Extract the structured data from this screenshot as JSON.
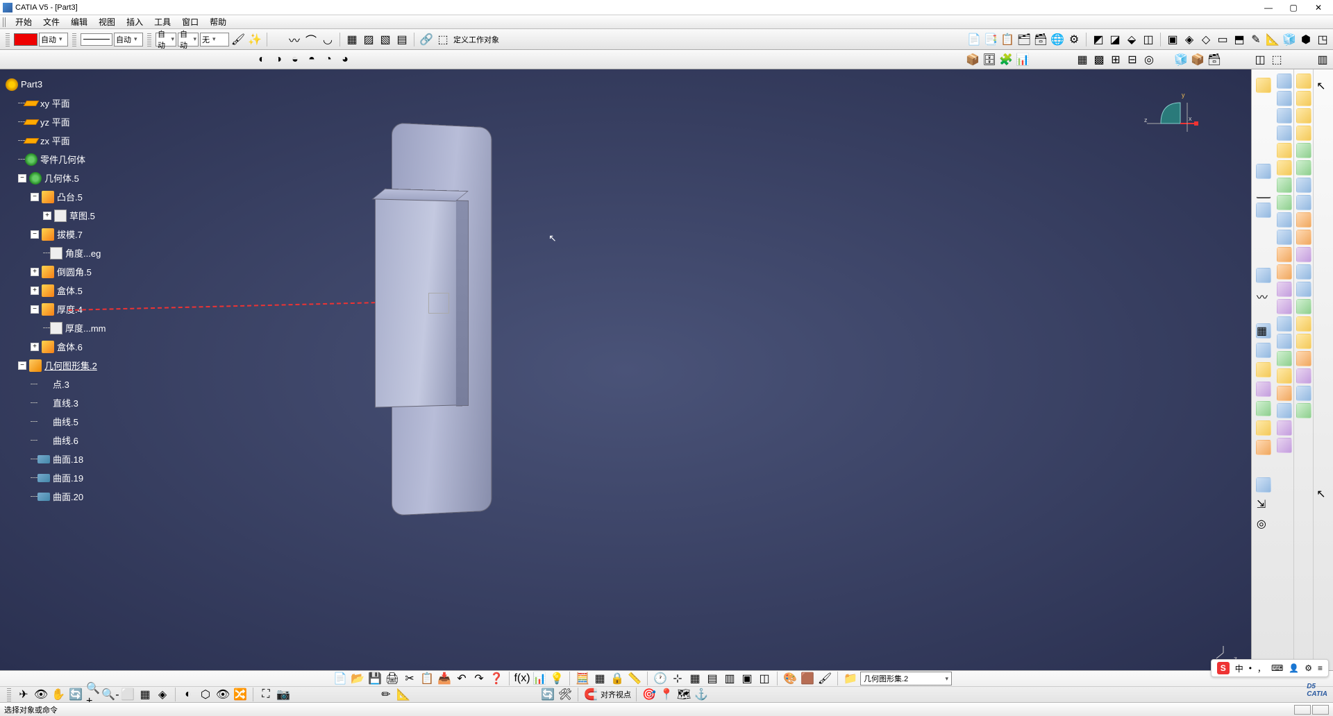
{
  "app": {
    "title": "CATIA V5 - [Part3]"
  },
  "menu": {
    "items": [
      "开始",
      "文件",
      "编辑",
      "视图",
      "插入",
      "工具",
      "窗口",
      "帮助"
    ]
  },
  "toolbar1": {
    "auto1": "自动",
    "auto2": "自动",
    "auto3": "自动",
    "auto4": "自动",
    "none": "无",
    "define_workspace": "定义工作对象"
  },
  "tree": {
    "root": "Part3",
    "planes": [
      "xy 平面",
      "yz 平面",
      "zx 平面"
    ],
    "part_body": "零件几何体",
    "body5": "几何体.5",
    "body5_children": {
      "pad5": "凸台.5",
      "sketch5": "草图.5",
      "draft7": "拔模.7",
      "angle": "角度...eg",
      "fillet5": "倒圆角.5",
      "shell5": "盒体.5",
      "thick4": "厚度.4",
      "thick_val": "厚度...mm",
      "shell6": "盒体.6"
    },
    "geoset2": "几何图形集.2",
    "geo_children": [
      "点.3",
      "直线.3",
      "曲线.5",
      "曲线.6",
      "曲面.18",
      "曲面.19",
      "曲面.20"
    ]
  },
  "compass": {
    "x": "x",
    "y": "y",
    "z": "z"
  },
  "bottom": {
    "align_viewpoint": "对齐视点",
    "current_set": "几何图形集.2"
  },
  "status": {
    "msg": "选择对象或命令"
  },
  "ime": {
    "brand": "S",
    "lang": "中",
    "sep": "•",
    "punct": "，"
  },
  "corner_axis": "z"
}
